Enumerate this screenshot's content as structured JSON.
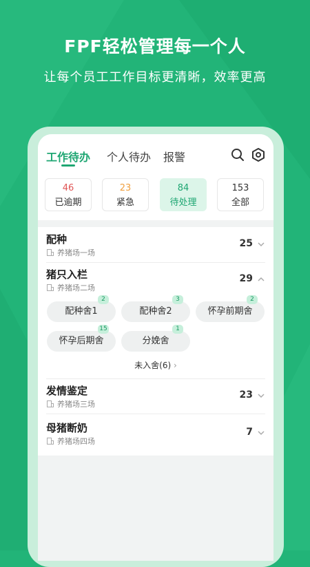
{
  "hero": {
    "title": "FPF轻松管理每一个人",
    "subtitle": "让每个员工工作目标更清晰，效率更高"
  },
  "colors": {
    "brand": "#22b478",
    "accent": "#1ea672",
    "overdue": "#e05555",
    "urgent": "#f0a040"
  },
  "tabs": [
    {
      "label": "工作待办",
      "active": true
    },
    {
      "label": "个人待办",
      "active": false
    },
    {
      "label": "报警",
      "active": false
    }
  ],
  "header_icons": [
    "search-icon",
    "settings-icon"
  ],
  "stats": [
    {
      "value": "46",
      "label": "已逾期"
    },
    {
      "value": "23",
      "label": "紧急"
    },
    {
      "value": "84",
      "label": "待处理",
      "active": true
    },
    {
      "value": "153",
      "label": "全部"
    }
  ],
  "tasks": [
    {
      "title": "配种",
      "farm": "养猪场一场",
      "count": "25",
      "expanded": false
    },
    {
      "title": "猪只入栏",
      "farm": "养猪场二场",
      "count": "29",
      "expanded": true,
      "chips": [
        {
          "label": "配种舍1",
          "badge": "2"
        },
        {
          "label": "配种舍2",
          "badge": "3"
        },
        {
          "label": "怀孕前期舍",
          "badge": "2"
        },
        {
          "label": "怀孕后期舍",
          "badge": "15"
        },
        {
          "label": "分娩舍",
          "badge": "1"
        }
      ],
      "more_label": "未入舍(6)"
    },
    {
      "title": "发情鉴定",
      "farm": "养猪场三场",
      "count": "23",
      "expanded": false
    },
    {
      "title": "母猪断奶",
      "farm": "养猪场四场",
      "count": "7",
      "expanded": false
    }
  ]
}
